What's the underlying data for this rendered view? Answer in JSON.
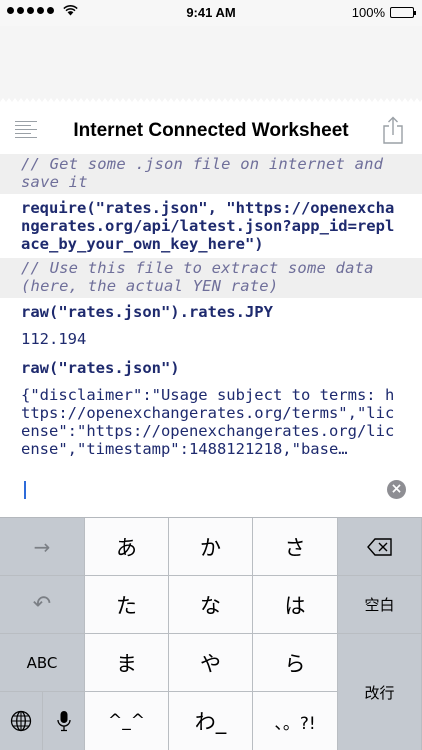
{
  "status_bar": {
    "time": "9:41 AM",
    "battery_text": "100%",
    "battery_level": 1.0,
    "signal_bars_filled": 5
  },
  "header": {
    "title": "Internet Connected Worksheet",
    "menu_icon": "list-icon",
    "share_icon": "share-icon"
  },
  "worksheet": {
    "cells": [
      {
        "kind": "comment",
        "text": "// Get some .json file on internet and save it"
      },
      {
        "kind": "input",
        "text": "require(\"rates.json\", \"https://openexchangerates.org/api/latest.json?app_id=replace_by_your_own_key_here\")"
      },
      {
        "kind": "comment",
        "text": "// Use this file to extract some data (here, the actual YEN rate)"
      },
      {
        "kind": "input",
        "text": "raw(\"rates.json\").rates.JPY"
      },
      {
        "kind": "output",
        "text": "112.194"
      },
      {
        "kind": "input",
        "text": "raw(\"rates.json\")"
      },
      {
        "kind": "output",
        "text": "{\"disclaimer\":\"Usage subject to terms: https://openexchangerates.org/terms\",\"license\":\"https://openexchangerates.org/license\",\"timestamp\":1488121218,\"base…"
      }
    ],
    "clear_icon": "close-circle-icon"
  },
  "keyboard": {
    "accent": "#2e6bd9",
    "keys": {
      "arrow": "→",
      "a": "あ",
      "ka": "か",
      "sa": "さ",
      "undo": "↶",
      "ta": "た",
      "na": "な",
      "ha": "は",
      "space": "空白",
      "abc": "ABC",
      "ma": "ま",
      "ya": "や",
      "ra": "ら",
      "return": "改行",
      "kaomoji": "^_^",
      "wa": "わ_",
      "punct": "、。?!"
    }
  }
}
